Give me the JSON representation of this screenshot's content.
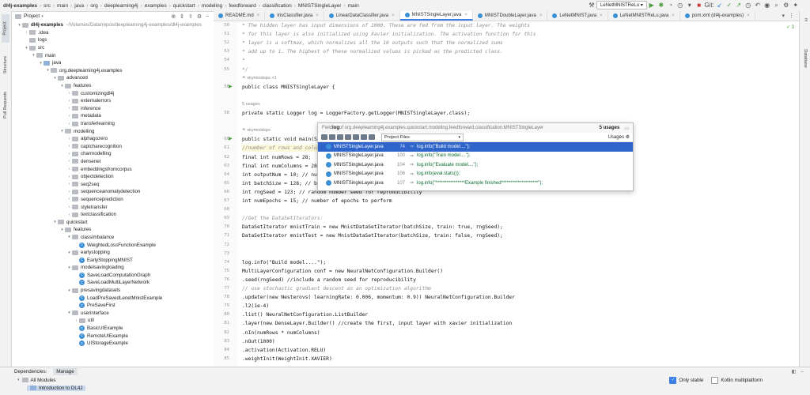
{
  "breadcrumbs": [
    "dl4j-examples",
    "src",
    "main",
    "java",
    "org",
    "deeplearning4j",
    "examples",
    "quickstart",
    "modeling",
    "feedforward",
    "classification",
    "MNISTSingleLayer",
    "main"
  ],
  "run_config": "LeNetMNISTReLu",
  "left_tabs": {
    "project": "Project",
    "structure": "Structure",
    "pull_requests": "Pull Requests"
  },
  "right_tabs": {
    "maven": "m",
    "database": "Database"
  },
  "project_panel": {
    "title": "Project"
  },
  "tree": [
    {
      "label": "dl4j-examples",
      "path": "~/Volumes/Data/repos/deeplearning4j-examples/dl4j-examples",
      "indent": 0,
      "arrow": "▾",
      "icon": "grey",
      "bold": true
    },
    {
      "label": ".idea",
      "indent": 1,
      "arrow": "›",
      "icon": "grey"
    },
    {
      "label": "logs",
      "indent": 1,
      "arrow": " ",
      "icon": "grey"
    },
    {
      "label": "src",
      "indent": 1,
      "arrow": "▾",
      "icon": "grey"
    },
    {
      "label": "main",
      "indent": 2,
      "arrow": "▾",
      "icon": "grey"
    },
    {
      "label": "java",
      "indent": 3,
      "arrow": "▾",
      "icon": "blue"
    },
    {
      "label": "org.deeplearning4j.examples",
      "indent": 4,
      "arrow": "▾",
      "icon": "grey"
    },
    {
      "label": "advanced",
      "indent": 5,
      "arrow": "▾",
      "icon": "grey"
    },
    {
      "label": "features",
      "indent": 6,
      "arrow": "▾",
      "icon": "grey"
    },
    {
      "label": "customizingdl4j",
      "indent": 7,
      "arrow": "›",
      "icon": "grey"
    },
    {
      "label": "externalerrors",
      "indent": 7,
      "arrow": "›",
      "icon": "grey"
    },
    {
      "label": "inference",
      "indent": 7,
      "arrow": "›",
      "icon": "grey"
    },
    {
      "label": "metadata",
      "indent": 7,
      "arrow": "›",
      "icon": "grey"
    },
    {
      "label": "transferlearning",
      "indent": 7,
      "arrow": "›",
      "icon": "grey"
    },
    {
      "label": "modelling",
      "indent": 6,
      "arrow": "▾",
      "icon": "grey"
    },
    {
      "label": "alphagozero",
      "indent": 7,
      "arrow": "›",
      "icon": "grey"
    },
    {
      "label": "captcharecognition",
      "indent": 7,
      "arrow": "›",
      "icon": "grey"
    },
    {
      "label": "charmodelling",
      "indent": 7,
      "arrow": "›",
      "icon": "grey"
    },
    {
      "label": "densenet",
      "indent": 7,
      "arrow": "›",
      "icon": "grey"
    },
    {
      "label": "embeddingsfromcorpus",
      "indent": 7,
      "arrow": "›",
      "icon": "grey"
    },
    {
      "label": "objectdetection",
      "indent": 7,
      "arrow": "›",
      "icon": "grey"
    },
    {
      "label": "seq2seq",
      "indent": 7,
      "arrow": "›",
      "icon": "grey"
    },
    {
      "label": "sequenceanomalydetection",
      "indent": 7,
      "arrow": "›",
      "icon": "grey"
    },
    {
      "label": "sequenceprediction",
      "indent": 7,
      "arrow": "›",
      "icon": "grey"
    },
    {
      "label": "styletransfer",
      "indent": 7,
      "arrow": "›",
      "icon": "grey"
    },
    {
      "label": "textclassification",
      "indent": 7,
      "arrow": "›",
      "icon": "grey"
    },
    {
      "label": "quickstart",
      "indent": 5,
      "arrow": "▾",
      "icon": "grey"
    },
    {
      "label": "features",
      "indent": 6,
      "arrow": "▾",
      "icon": "grey"
    },
    {
      "label": "classimbalance",
      "indent": 7,
      "arrow": "▾",
      "icon": "grey"
    },
    {
      "label": "WeightedLossFunctionExample",
      "indent": 8,
      "arrow": " ",
      "icon": "class"
    },
    {
      "label": "earlystopping",
      "indent": 7,
      "arrow": "▾",
      "icon": "grey"
    },
    {
      "label": "EarlyStoppingMNIST",
      "indent": 8,
      "arrow": " ",
      "icon": "class"
    },
    {
      "label": "modelsavingloading",
      "indent": 7,
      "arrow": "▾",
      "icon": "grey"
    },
    {
      "label": "SaveLoadComputationGraph",
      "indent": 8,
      "arrow": " ",
      "icon": "class"
    },
    {
      "label": "SaveLoadMultiLayerNetwork",
      "indent": 8,
      "arrow": " ",
      "icon": "class"
    },
    {
      "label": "presavingdatasets",
      "indent": 7,
      "arrow": "▾",
      "icon": "grey"
    },
    {
      "label": "LoadPreSavedLenetMnistExample",
      "indent": 8,
      "arrow": " ",
      "icon": "class"
    },
    {
      "label": "PreSaveFirst",
      "indent": 8,
      "arrow": " ",
      "icon": "class"
    },
    {
      "label": "userinterface",
      "indent": 7,
      "arrow": "▾",
      "icon": "grey"
    },
    {
      "label": "util",
      "indent": 8,
      "arrow": "›",
      "icon": "grey"
    },
    {
      "label": "BasicUIExample",
      "indent": 8,
      "arrow": " ",
      "icon": "class"
    },
    {
      "label": "RemoteUIExample",
      "indent": 8,
      "arrow": " ",
      "icon": "class"
    },
    {
      "label": "UIStorageExample",
      "indent": 8,
      "arrow": " ",
      "icon": "class"
    }
  ],
  "file_tabs": [
    {
      "label": "README.md",
      "active": false
    },
    {
      "label": "IrisClassifier.java",
      "active": false
    },
    {
      "label": "LinearDataClassifier.java",
      "active": false
    },
    {
      "label": "MNISTSingleLayer.java",
      "active": true
    },
    {
      "label": "MNISTDoubleLayer.java",
      "active": false
    },
    {
      "label": "LeNetMNIST.java",
      "active": false
    },
    {
      "label": "LeNetMNISTReLu.java",
      "active": false
    },
    {
      "label": "pom.xml (dl4j-examples)",
      "active": false
    }
  ],
  "code": [
    {
      "n": "50",
      "t": " * The hidden layer has input dimensions of 1000. These are fed from the input layer. The weights",
      "k": "cm"
    },
    {
      "n": "51",
      "t": " * for this layer is also initialized using Xavier initialization. The activation function for this",
      "k": "cm"
    },
    {
      "n": "52",
      "t": " * layer is a softmax, which normalizes all the 10 outputs such that the normalized sums",
      "k": "cm"
    },
    {
      "n": "53",
      "t": " * add up to 1. The highest of these normalized values is picked as the predicted class.",
      "k": "cm"
    },
    {
      "n": "54",
      "t": " *",
      "k": "cm"
    },
    {
      "n": "55",
      "t": " */",
      "k": "cm"
    },
    {
      "n": "",
      "t": "≗ skymindops +1",
      "k": "meta"
    },
    {
      "n": "56",
      "t": "public class MNISTSingleLayer {",
      "k": "",
      "run": true
    },
    {
      "n": "",
      "t": "",
      "k": ""
    },
    {
      "n": "",
      "t": "5 usages",
      "k": "meta"
    },
    {
      "n": "58",
      "t": "    private static Logger log = LoggerFactory.getLogger(MNISTSingleLayer.class);",
      "k": ""
    },
    {
      "n": "",
      "t": "",
      "k": ""
    },
    {
      "n": "",
      "t": "≗ skymindops",
      "k": "meta"
    },
    {
      "n": "60",
      "t": "    public static void main(String[] args) throws Exception {",
      "k": "",
      "run": true
    },
    {
      "n": "61",
      "t": "        //number of rows and columns in the input pictures",
      "k": "cm",
      "hl": true
    },
    {
      "n": "62",
      "t": "        final int numRows = 28;",
      "k": ""
    },
    {
      "n": "63",
      "t": "        final int numColumns = 28;",
      "k": ""
    },
    {
      "n": "64",
      "t": "        int outputNum = 10; // number of output classes",
      "k": ""
    },
    {
      "n": "65",
      "t": "        int batchSize = 128; // batch size for each epoch",
      "k": ""
    },
    {
      "n": "66",
      "t": "        int rngSeed = 123; // random number seed for reproducibility",
      "k": ""
    },
    {
      "n": "67",
      "t": "        int numEpochs = 15; // number of epochs to perform",
      "k": ""
    },
    {
      "n": "68",
      "t": "",
      "k": ""
    },
    {
      "n": "69",
      "t": "        //Get the DataSetIterators:",
      "k": "cm"
    },
    {
      "n": "70",
      "t": "        DataSetIterator mnistTrain = new MnistDataSetIterator(batchSize,  train: true, rngSeed);",
      "k": ""
    },
    {
      "n": "71",
      "t": "        DataSetIterator mnistTest = new MnistDataSetIterator(batchSize,  train: false, rngSeed);",
      "k": ""
    },
    {
      "n": "72",
      "t": "",
      "k": ""
    },
    {
      "n": "73",
      "t": "",
      "k": ""
    },
    {
      "n": "74",
      "t": "        log.info(\"Build model....\");",
      "k": ""
    },
    {
      "n": "75",
      "t": "        MultiLayerConfiguration conf = new NeuralNetConfiguration.Builder()",
      "k": ""
    },
    {
      "n": "76",
      "t": "                .seed(rngSeed) //include a random seed for reproducibility",
      "k": ""
    },
    {
      "n": "77",
      "t": "                // use stochastic gradient descent as an optimization algorithm",
      "k": "cm"
    },
    {
      "n": "78",
      "t": "                .updater(new Nesterovs( learningRate: 0.006,  momentum: 0.9)) NeuralNetConfiguration.Builder",
      "k": ""
    },
    {
      "n": "79",
      "t": "                .l2(1e-4)",
      "k": ""
    },
    {
      "n": "80",
      "t": "                .list()  NeuralNetConfiguration.ListBuilder",
      "k": ""
    },
    {
      "n": "81",
      "t": "                .layer(new DenseLayer.Builder() //create the first, input layer with xavier initialization",
      "k": ""
    },
    {
      "n": "82",
      "t": "                        .nIn(numRows * numColumns)",
      "k": ""
    },
    {
      "n": "83",
      "t": "                        .nOut(1000)",
      "k": ""
    },
    {
      "n": "84",
      "t": "                        .activation(Activation.RELU)",
      "k": ""
    },
    {
      "n": "85",
      "t": "                        .weightInit(WeightInit.XAVIER)",
      "k": ""
    }
  ],
  "popup": {
    "prefix": "Field ",
    "field": "log",
    "scope_text": " of org.deeplearning4j.examples.quickstart.modeling.feedforward.classification.MNISTSingleLayer",
    "count": "5 usages",
    "scope": "Project Files",
    "usages_label": "Usages",
    "rows": [
      {
        "file": "MNISTSingleLayer.java",
        "line": "74",
        "code": "log.info(\"Build model....\");",
        "sel": true
      },
      {
        "file": "MNISTSingleLayer.java",
        "line": "100",
        "code": "log.info(\"Train model....\");",
        "sel": false
      },
      {
        "file": "MNISTSingleLayer.java",
        "line": "104",
        "code": "log.info(\"Evaluate model....\");",
        "sel": false
      },
      {
        "file": "MNISTSingleLayer.java",
        "line": "106",
        "code": "log.info(eval.stats());",
        "sel": false
      },
      {
        "file": "MNISTSingleLayer.java",
        "line": "107",
        "code": "log.info(\"****************Example finished********************\");",
        "sel": false
      }
    ]
  },
  "bottom": {
    "tab_dependencies": "Dependencies:",
    "tab_manage": "Manage",
    "all_modules": "All Modules",
    "intro": "Introduction to DL4J",
    "only_stable": "Only stable",
    "kotlin": "Kotlin multiplatform"
  }
}
